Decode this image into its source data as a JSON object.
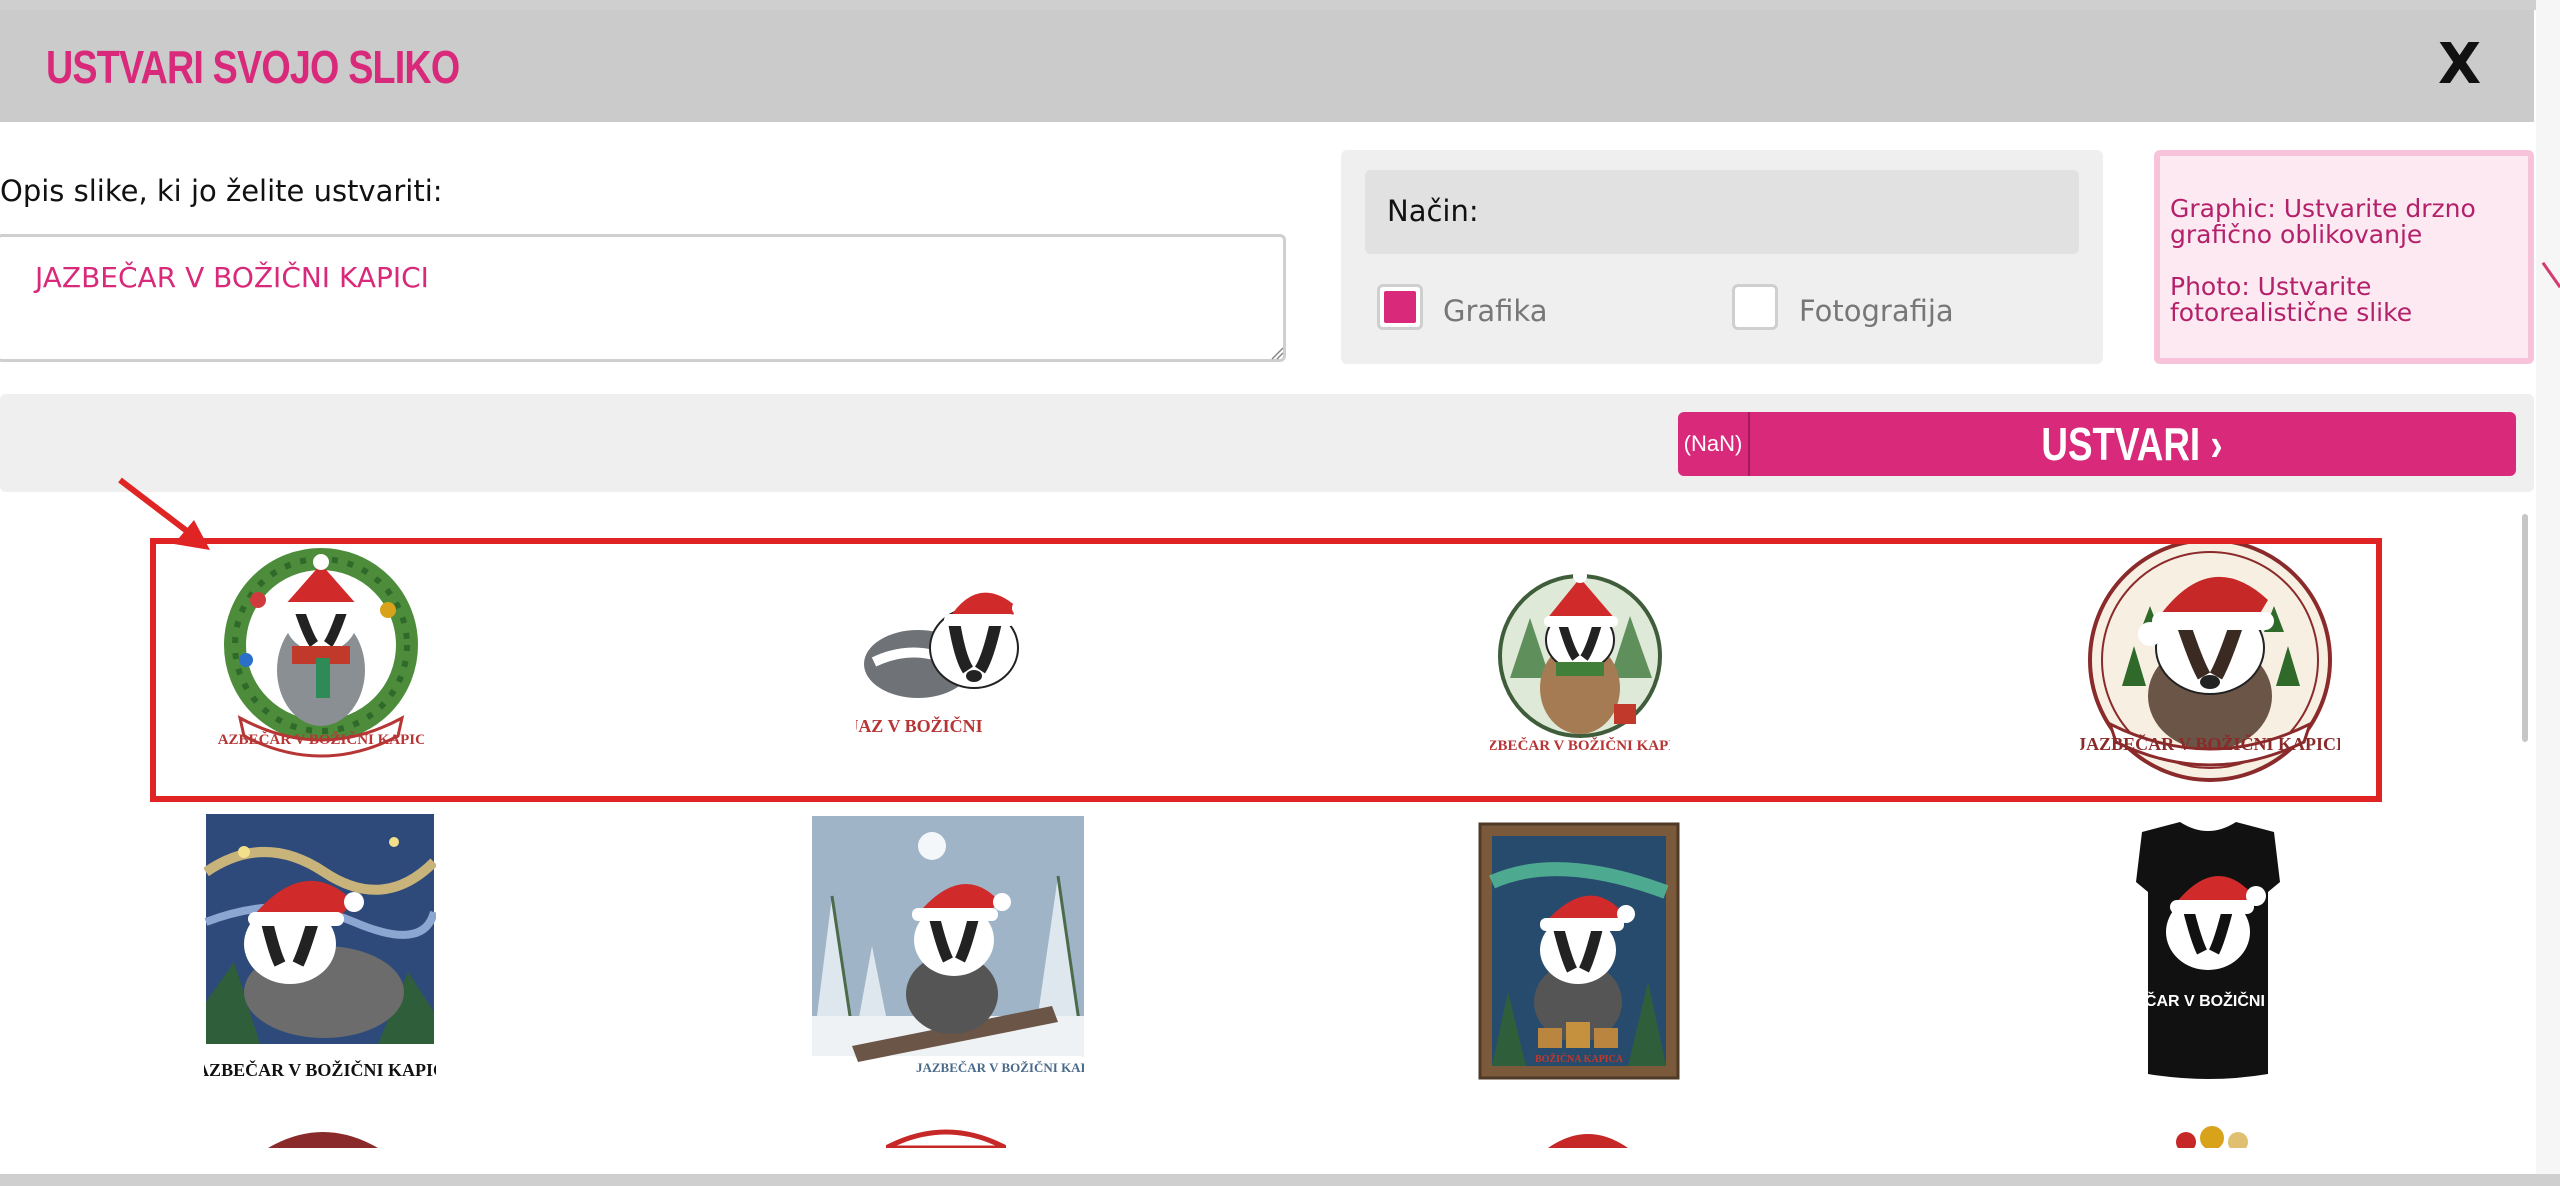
{
  "modal": {
    "title": "USTVARI SVOJO SLIKO",
    "close_label": "X"
  },
  "description": {
    "label": "Opis slike, ki jo želite ustvariti:",
    "value": "JAZBEČAR V BOŽIČNI KAPICI"
  },
  "mode": {
    "label": "Način:",
    "options": [
      {
        "label": "Grafika",
        "checked": true
      },
      {
        "label": "Fotografija",
        "checked": false
      }
    ]
  },
  "info": {
    "graphic": "Graphic: Ustvarite drzno grafično oblikovanje",
    "photo": "Photo: Ustvarite fotorealistične slike"
  },
  "action": {
    "cost_label": "(NaN)",
    "create_label": "USTVARI ›"
  },
  "gallery": {
    "row1": [
      {
        "icon": "badger-wreath-badge",
        "caption": "JAZBEČAR V BOŽIČNI KAPICI"
      },
      {
        "icon": "badger-cartoon-santa-hat",
        "caption": "JAZ  V BOŽIČNI"
      },
      {
        "icon": "badger-circle-badge",
        "caption": "JAZBEČAR V BOŽIČNI KAPICI"
      },
      {
        "icon": "badger-ornate-circle-badge",
        "caption": "JAZBEČAR V BOŽIČNI KAPICI"
      }
    ],
    "row2": [
      {
        "icon": "badger-starry-night",
        "caption": "JAZBEČAR V BOŽIČNI KAPICI"
      },
      {
        "icon": "badger-snowy-forest",
        "caption": "JAZBEČAR V BOŽIČNI KAPICI"
      },
      {
        "icon": "badger-framed-aurora",
        "caption": "BOŽIČNA KAPICA"
      },
      {
        "icon": "badger-black-tshirt",
        "caption": "JAZBEČAR V BOŽIČNI KAPICI"
      }
    ]
  },
  "colors": {
    "accent": "#d9297a",
    "highlight": "#e02424",
    "header": "#cbcbcb"
  }
}
